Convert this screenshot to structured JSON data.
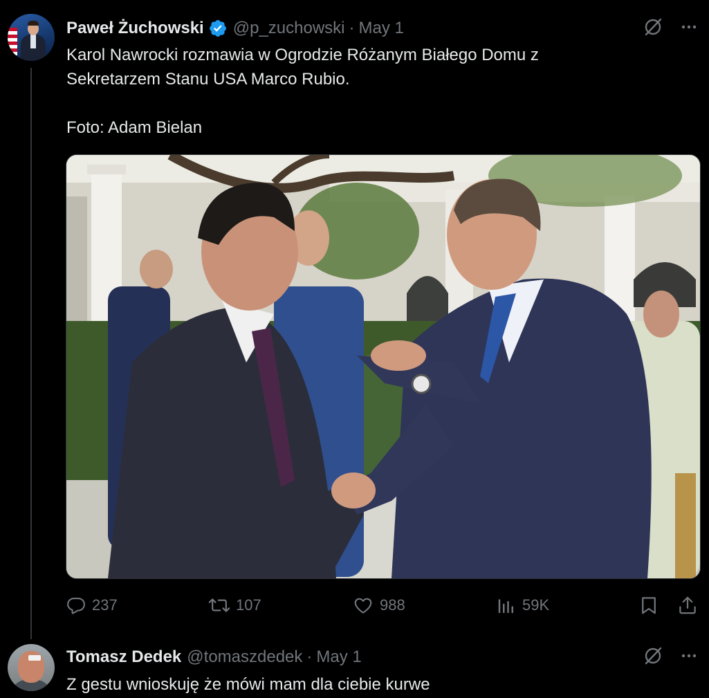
{
  "tweet": {
    "author_name": "Paweł Żuchowski",
    "handle": "@p_zuchowski",
    "separator": "·",
    "date": "May 1",
    "text": "Karol Nawrocki rozmawia w Ogrodzie Różanym Białego Domu z\nSekretarzem Stanu USA Marco Rubio.\n\nFoto: Adam Bielan",
    "verified_icon": "verified-badge-icon",
    "verified_color": "#1d9bf0",
    "actions": {
      "replies": "237",
      "reposts": "107",
      "likes": "988",
      "views": "59K"
    }
  },
  "reply": {
    "author_name": "Tomasz Dedek",
    "handle": "@tomaszdedek",
    "separator": "·",
    "date": "May 1",
    "text": "Z gestu wnioskuję że mówi mam dla ciebie kurwe"
  },
  "colors": {
    "background": "#000000",
    "text_primary": "#e7e9ea",
    "text_secondary": "#71767b",
    "thread_line": "#333639"
  }
}
